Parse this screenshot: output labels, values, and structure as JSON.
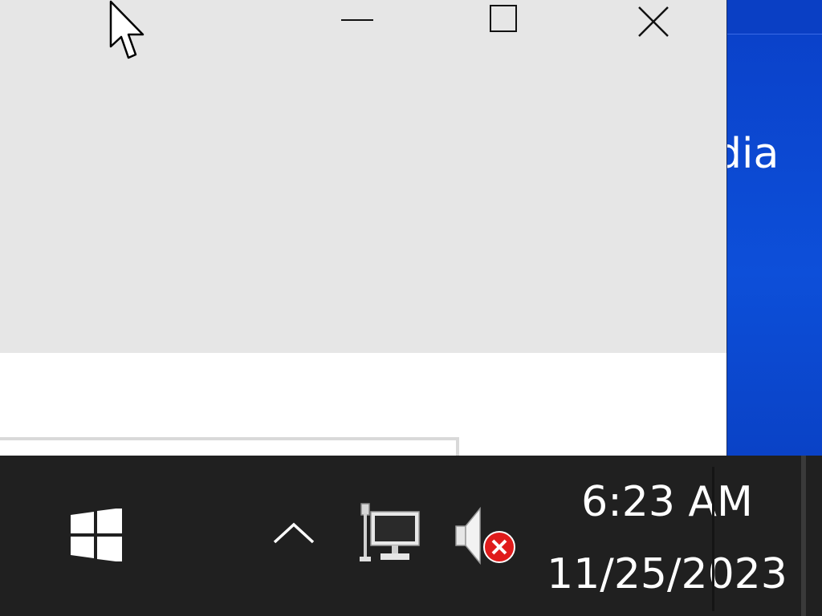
{
  "window": {
    "controls": {
      "minimize_icon": "minimize-icon",
      "maximize_icon": "maximize-icon",
      "close_icon": "close-icon"
    }
  },
  "desktop": {
    "partial_label": "dia",
    "color": "#0d4fd9"
  },
  "taskbar": {
    "start_icon": "windows-logo-icon",
    "tray_icons": [
      "chevron-up-icon",
      "network-icon",
      "volume-muted-icon"
    ],
    "clock": {
      "time": "6:23 AM",
      "date": "11/25/2023"
    },
    "background": "#202020"
  }
}
